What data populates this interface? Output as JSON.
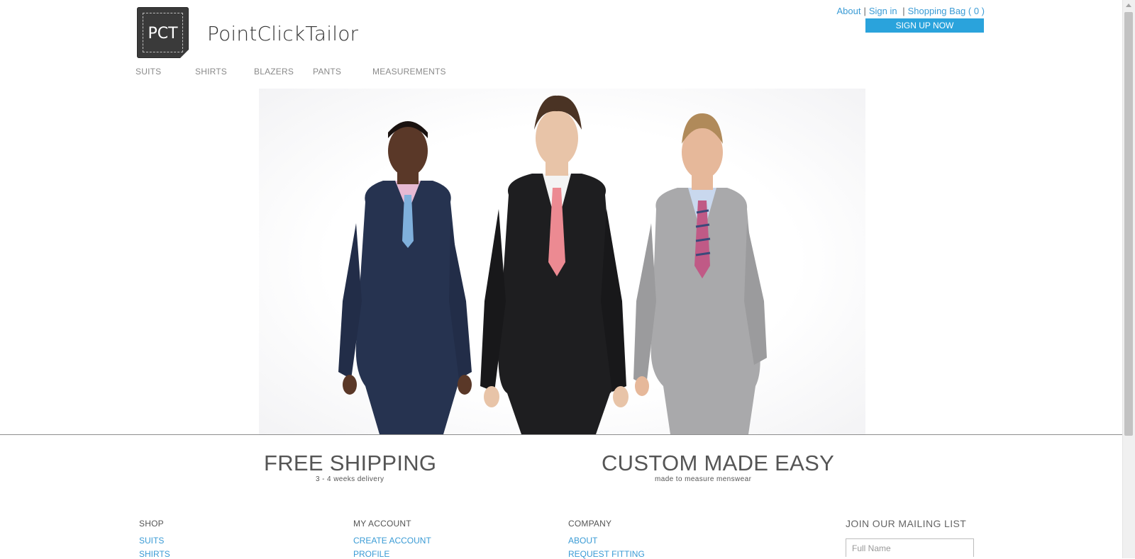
{
  "brand": {
    "logo_text": "PCT",
    "name": "PointClickTailor"
  },
  "top_links": {
    "about": "About",
    "sign_in": "Sign in",
    "shopping_bag": "Shopping Bag ( 0 )",
    "separator": "|"
  },
  "signup_label": "SIGN UP NOW",
  "nav": {
    "suits": "SUITS",
    "shirts": "SHIRTS",
    "blazers": "BLAZERS",
    "pants": "PANTS",
    "measurements": "MEASUREMENTS"
  },
  "hero": {
    "colors": {
      "suit_navy": "#263350",
      "suit_black": "#1e1e20",
      "suit_grey": "#a9a9ab",
      "tie_blue": "#7fb0dc",
      "tie_pink": "#ec8a92",
      "tie_stripe": "#c05a86",
      "skin_dark": "#5a3828",
      "skin_light": "#e8c4a8"
    }
  },
  "promos": {
    "shipping": {
      "title": "FREE SHIPPING",
      "subtitle": "3 - 4 weeks delivery"
    },
    "custom": {
      "title": "CUSTOM MADE EASY",
      "subtitle": "made to measure menswear"
    }
  },
  "footer": {
    "shop": {
      "heading": "SHOP",
      "links": [
        "SUITS",
        "SHIRTS"
      ]
    },
    "account": {
      "heading": "MY ACCOUNT",
      "links": [
        "CREATE ACCOUNT",
        "PROFILE"
      ]
    },
    "company": {
      "heading": "COMPANY",
      "links": [
        "ABOUT",
        "REQUEST FITTING"
      ]
    },
    "mailing": {
      "heading": "JOIN OUR MAILING LIST",
      "name_placeholder": "Full Name"
    }
  }
}
